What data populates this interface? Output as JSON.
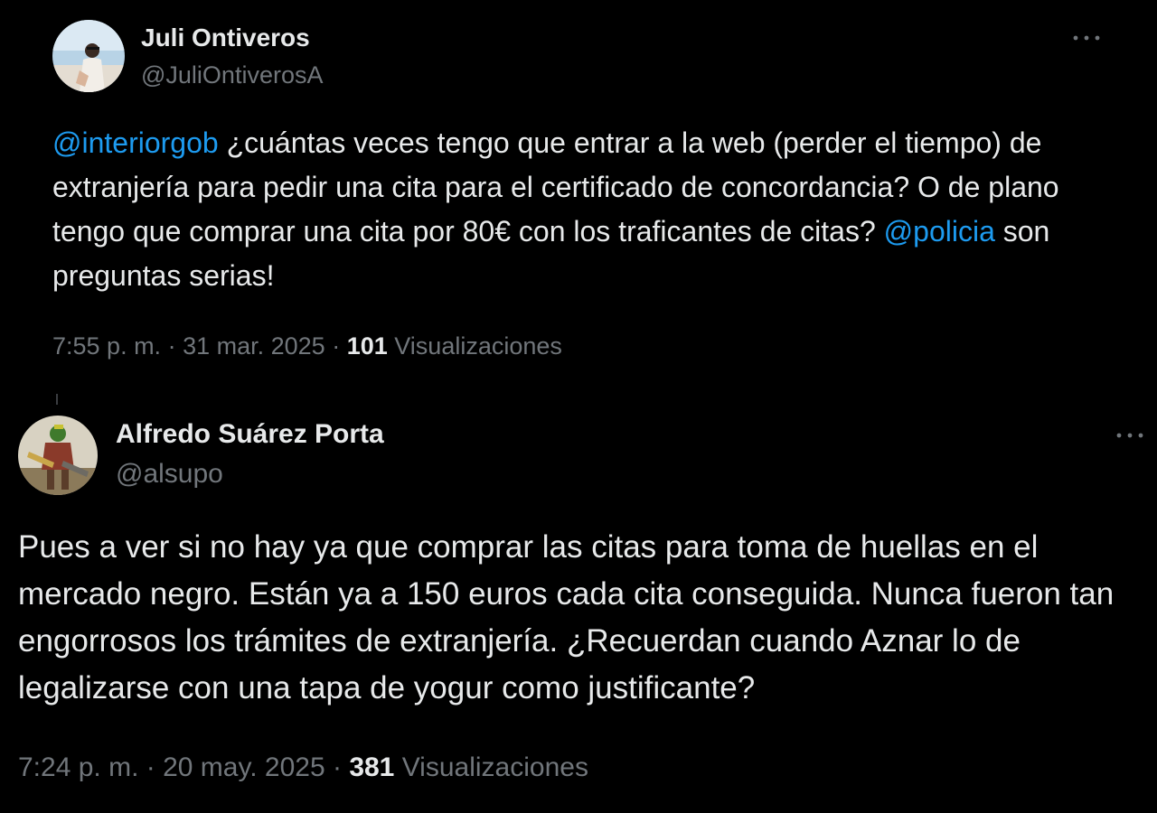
{
  "tweets": [
    {
      "author_name": "Juli Ontiveros",
      "author_handle": "@JuliOntiverosA",
      "avatar": "profile-photo",
      "more_icon": "more-horizontal-icon",
      "mention_1": "@interiorgob",
      "text_1": " ¿cuántas veces tengo que entrar a la web (perder el tiempo) de extranjería para pedir una cita para el certificado de concordancia? O de plano tengo que comprar una cita por 80€ con los traficantes de citas? ",
      "mention_2": "@policia",
      "text_2": " son preguntas serias!",
      "time": "7:55 p. m.",
      "date": "31 mar. 2025",
      "views_count": "101",
      "views_label": "Visualizaciones"
    },
    {
      "author_name": "Alfredo Suárez Porta",
      "author_handle": "@alsupo",
      "avatar": "profile-photo",
      "more_icon": "more-horizontal-icon",
      "text": "Pues a ver si no hay ya que comprar las citas para toma de huellas en el mercado negro. Están ya a 150 euros cada cita conseguida. Nunca fueron tan engorrosos los trámites de extranjería. ¿Recuerdan cuando Aznar lo de legalizarse con una tapa de yogur como justificante?",
      "time": "7:24 p. m.",
      "date": "20 may. 2025",
      "views_count": "381",
      "views_label": "Visualizaciones"
    }
  ],
  "separator": " · ",
  "colors": {
    "background": "#000000",
    "text": "#e7e9ea",
    "secondary": "#71767b",
    "link": "#1d9bf0"
  }
}
